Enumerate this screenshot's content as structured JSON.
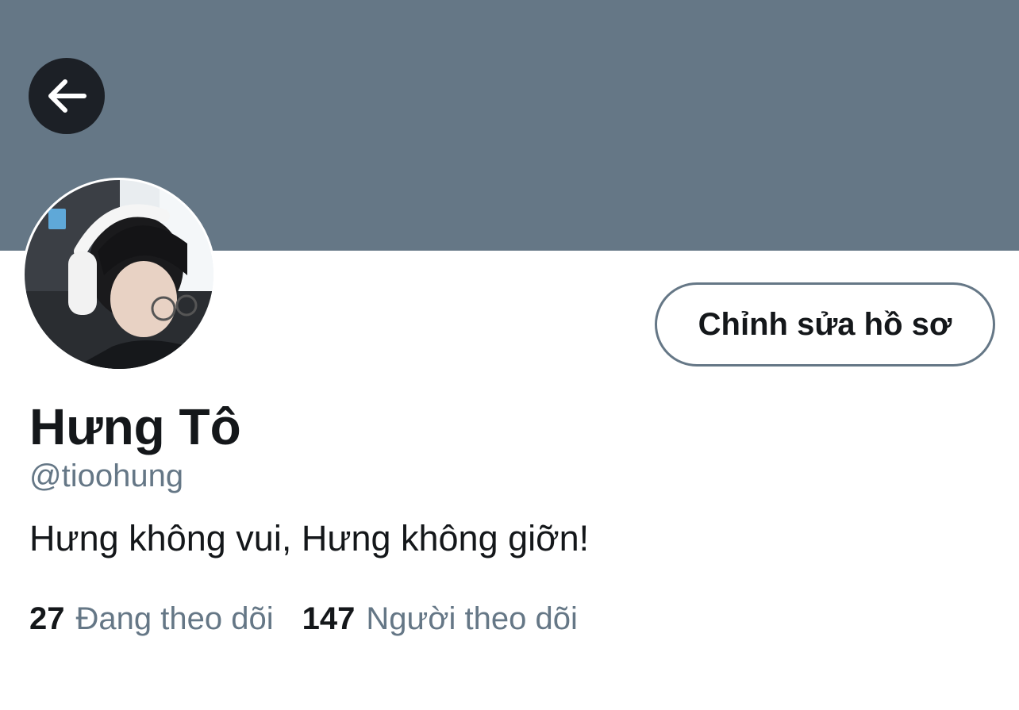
{
  "profile": {
    "display_name": "Hưng Tô",
    "handle": "@tioohung",
    "bio": "Hưng không vui, Hưng không giỡn!",
    "edit_profile_label": "Chỉnh sửa hồ sơ",
    "stats": {
      "following_count": "27",
      "following_label": "Đang theo dõi",
      "followers_count": "147",
      "followers_label": "Người theo dõi"
    }
  },
  "icons": {
    "back": "arrow-left-icon"
  },
  "colors": {
    "banner": "#657786",
    "text_primary": "#14171a",
    "text_secondary": "#657786",
    "back_button_bg": "#1c2026"
  }
}
